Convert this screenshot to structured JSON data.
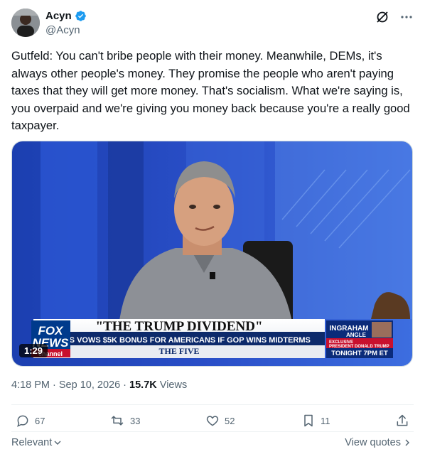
{
  "author": {
    "display_name": "Acyn",
    "handle": "@Acyn"
  },
  "tweet": {
    "text": "Gutfeld: You can't bribe people with their money. Meanwhile, DEMs, it's always other people's money. They promise the people who aren't paying taxes that they will get more money. That's socialism. What we're saying is, you overpaid and we're giving you money back because you're a really good taxpayer."
  },
  "video": {
    "duration": "1:29",
    "chyron_headline": "\"THE TRUMP DIVIDEND\"",
    "chyron_subhead": "POTUS VOWS $5K BONUS FOR AMERICANS IF GOP WINS MIDTERMS",
    "show_name": "THE FIVE",
    "network_logo_top": "FOX",
    "network_logo_bottom": "NEWS",
    "network_logo_channel": "channel",
    "promo_show": "INGRAHAM",
    "promo_show_sub": "ANGLE",
    "promo_line1": "EXCLUSIVE",
    "promo_line2": "PRESIDENT DONALD TRUMP",
    "promo_time": "TONIGHT 7PM ET"
  },
  "meta": {
    "time_date": "4:18 PM · Sep 10, 2026 · ",
    "views_count": "15.7K",
    "views_label": " Views"
  },
  "actions": {
    "replies": "67",
    "reposts": "33",
    "likes": "52",
    "bookmarks": "11"
  },
  "footer": {
    "sort_label": "Relevant",
    "view_quotes": "View quotes"
  },
  "colors": {
    "verified": "#1d9bf0",
    "secondary_text": "#536471",
    "fox_blue": "#003a8c",
    "chyron_red": "#c8102e"
  }
}
